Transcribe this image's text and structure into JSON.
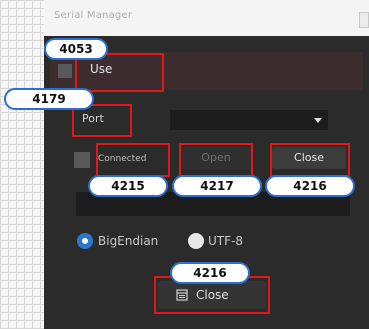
{
  "window": {
    "title": "Serial Manager"
  },
  "use": {
    "label": "Use"
  },
  "port": {
    "label": "Port",
    "selected": ""
  },
  "connection": {
    "label": "Connected"
  },
  "buttons": {
    "open": "Open",
    "close": "Close",
    "close_bottom": "Close"
  },
  "encoding": {
    "option_1": "BigEndian",
    "option_2": "UTF-8",
    "selected": "BigEndian"
  },
  "badges": {
    "use": "4053",
    "port": "4179",
    "connected": "4215",
    "open": "4217",
    "close_top": "4216",
    "close_bottom": "4216"
  },
  "colors": {
    "highlight": "#e01818",
    "badge_border": "#2c6fce",
    "radio_selected": "#2f76c8",
    "panel": "#2b2b2b"
  }
}
